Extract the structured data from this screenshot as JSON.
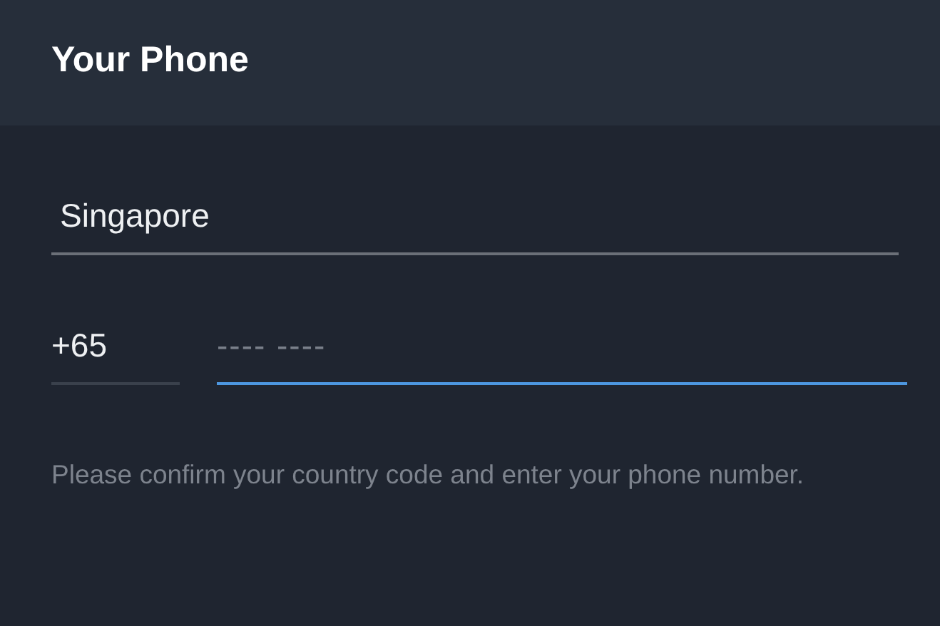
{
  "header": {
    "title": "Your Phone"
  },
  "country": {
    "value": "Singapore"
  },
  "code": {
    "value": "+65",
    "focused": false
  },
  "phone": {
    "placeholder": "---- ----",
    "focused": true
  },
  "hint": "Please confirm your country code and enter your phone number."
}
